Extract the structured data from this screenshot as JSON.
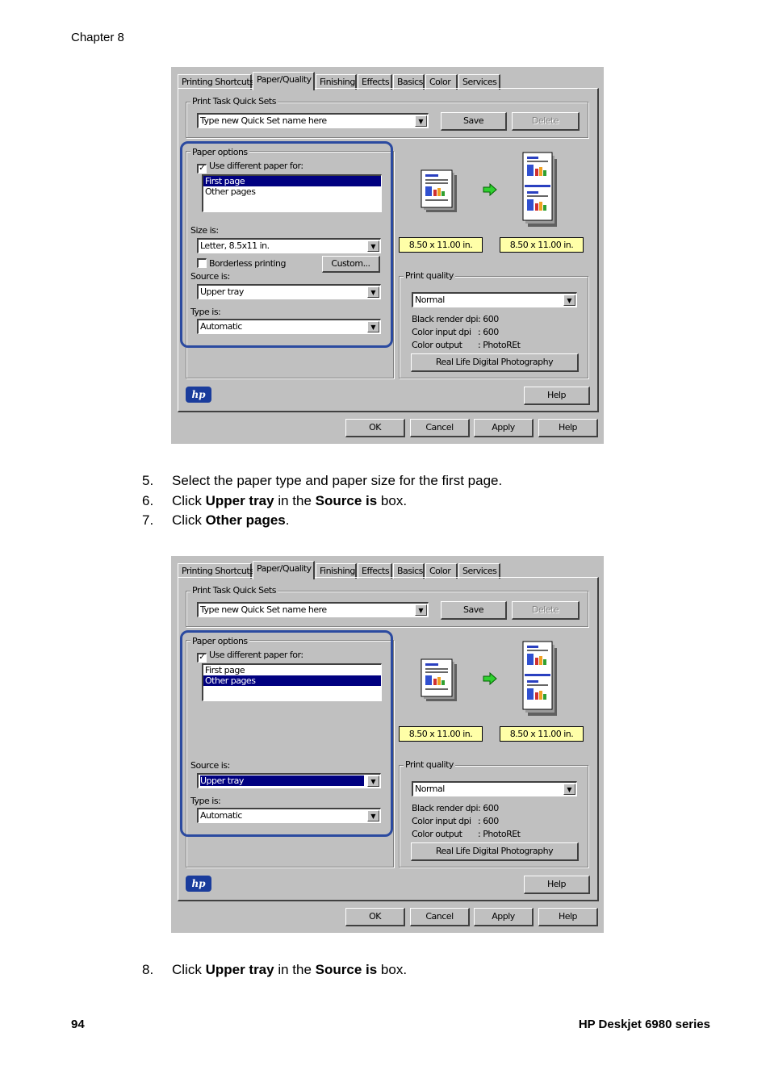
{
  "header": {
    "chapter": "Chapter 8"
  },
  "footer": {
    "page_number": "94",
    "product": "HP Deskjet 6980 series"
  },
  "dialog": {
    "tabs": [
      "Printing Shortcuts",
      "Paper/Quality",
      "Finishing",
      "Effects",
      "Basics",
      "Color",
      "Services"
    ],
    "quick_sets_label": "Print Task Quick Sets",
    "quick_sets_value": "Type new Quick Set name here",
    "save_label": "Save",
    "delete_label": "Delete",
    "paper_options_label": "Paper options",
    "use_different_label": "Use different paper for:",
    "list_items": [
      "First page",
      "Other pages"
    ],
    "size_label": "Size is:",
    "size_value": "Letter, 8.5x11 in.",
    "borderless_label": "Borderless printing",
    "custom_label": "Custom...",
    "source_label": "Source is:",
    "source_value": "Upper tray",
    "type_label": "Type is:",
    "type_value": "Automatic",
    "size_badge_1": "8.50 x 11.00 in.",
    "size_badge_2": "8.50 x 11.00 in.",
    "arrow_icon": "right-arrow-icon",
    "print_quality_label": "Print quality",
    "print_quality_value": "Normal",
    "black_dpi_label": "Black render dpi",
    "black_dpi_value": ": 600",
    "color_dpi_label": "Color input dpi",
    "color_dpi_value": ": 600",
    "color_output_label": "Color output",
    "color_output_value": ": PhotoREt",
    "real_life_label": "Real Life Digital Photography",
    "help_label": "Help",
    "hp_logo_text": "hp",
    "ok_label": "OK",
    "cancel_label": "Cancel",
    "apply_label": "Apply",
    "help2_label": "Help"
  },
  "steps_1": [
    {
      "num": "5.",
      "parts": [
        {
          "t": "Select the paper type and paper size for the first page."
        }
      ]
    },
    {
      "num": "6.",
      "parts": [
        {
          "t": "Click "
        },
        {
          "b": "Upper tray"
        },
        {
          "t": " in the "
        },
        {
          "b": "Source is"
        },
        {
          "t": " box."
        }
      ]
    },
    {
      "num": "7.",
      "parts": [
        {
          "t": "Click "
        },
        {
          "b": "Other pages"
        },
        {
          "t": "."
        }
      ]
    }
  ],
  "steps_2": [
    {
      "num": "8.",
      "parts": [
        {
          "t": "Click "
        },
        {
          "b": "Upper tray"
        },
        {
          "t": " in the "
        },
        {
          "b": "Source is"
        },
        {
          "t": " box."
        }
      ]
    }
  ]
}
